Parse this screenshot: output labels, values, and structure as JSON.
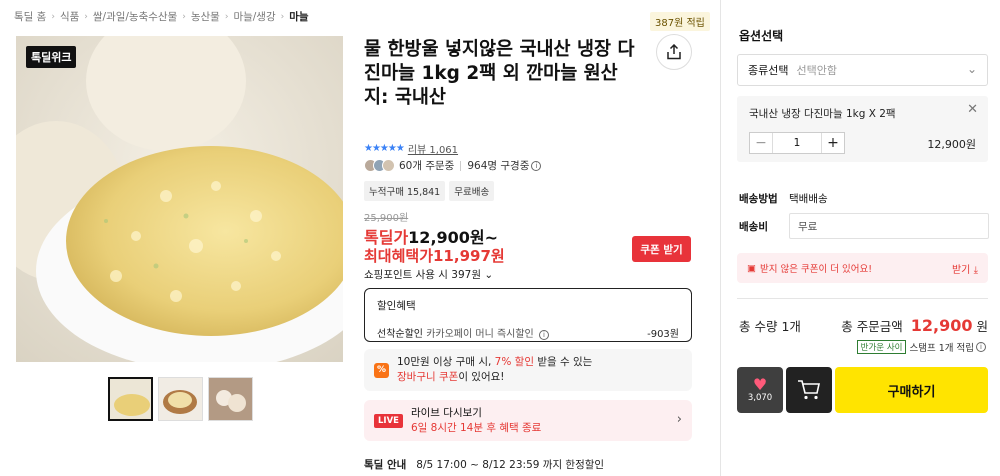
{
  "breadcrumb": [
    "톡딜 홈",
    "식품",
    "쌀/과일/농축수산물",
    "농산물",
    "마늘/생강",
    "마늘"
  ],
  "product": {
    "brand_tag": "톡딜위크",
    "points_badge": "387원 적립",
    "title": "물 한방울 넣지않은 국내산 냉장 다진마늘 1kg 2팩 외 깐마늘 원산지: 국내산",
    "stars": "★★★★★",
    "review_text": "리뷰 1,061",
    "buyers_text": "60개 주문중",
    "watchers_text": "964명 구경중",
    "chips": [
      "누적구매 15,841",
      "무료배송"
    ],
    "original_price": "25,900원",
    "deal_label": "톡딜가",
    "deal_price": "12,900원~",
    "max_benefit": "최대혜택가11,997원",
    "coupon_button": "쿠폰 받기",
    "shop_point": "쇼핑포인트 사용 시 397원"
  },
  "discount": {
    "heading": "할인혜택",
    "first_label": "선착순할인",
    "first_desc": "카카오페이 머니 즉시할인",
    "first_amount": "-903원"
  },
  "promo": {
    "icon": "%",
    "line1_a": "10만원 이상 구매 시, ",
    "line1_red": "7% 할인",
    "line1_b": " 받을 수 있는",
    "line2_red": "장바구니 쿠폰",
    "line2_b": "이 있어요!"
  },
  "live": {
    "badge": "LIVE",
    "title": "라이브 다시보기",
    "subtitle": "6일 8시간 14분 후 혜택 종료"
  },
  "sale_info": {
    "label": "톡딜 안내",
    "period": "8/5 17:00 ~ 8/12 23:59 까지 한정할인"
  },
  "option_panel": {
    "title": "옵션선택",
    "select_label": "종류선택",
    "select_placeholder": "선택안함",
    "item_name": "국내산 냉장 다진마늘 1kg X 2팩",
    "quantity": "1",
    "item_price": "12,900원",
    "ship_method_label": "배송방법",
    "ship_method_value": "택배배송",
    "ship_cost_label": "배송비",
    "ship_cost_value": "무료",
    "coupon_notice": "받지 않은 쿠폰이 더 있어요!",
    "coupon_download": "받기",
    "total_qty": "총 수량 1개",
    "total_label": "총 주문금액",
    "total_amount": "12,900",
    "total_unit": "원",
    "stamp_tag": "반가운 사이",
    "stamp_text": "스탬프 1개 적립",
    "like_count": "3,070",
    "buy_button": "구매하기"
  },
  "colors": {
    "accent_red": "#e53935",
    "buy_yellow": "#ffe400",
    "star_blue": "#3b82f6"
  }
}
